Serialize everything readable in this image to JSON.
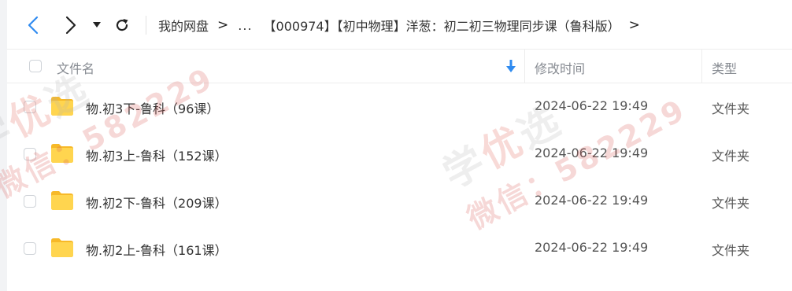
{
  "nav": {
    "breadcrumb": {
      "root": "我的网盘",
      "ellipsis": "...",
      "current": "【000974】【初中物理】洋葱：初二初三物理同步课（鲁科版）"
    }
  },
  "table": {
    "headers": {
      "name": "文件名",
      "modified": "修改时间",
      "type": "类型"
    },
    "rows": [
      {
        "name": "物.初3下-鲁科（96课）",
        "modified": "2024-06-22 19:49",
        "type": "文件夹"
      },
      {
        "name": "物.初3上-鲁科（152课）",
        "modified": "2024-06-22 19:49",
        "type": "文件夹"
      },
      {
        "name": "物.初2下-鲁科（209课）",
        "modified": "2024-06-22 19:49",
        "type": "文件夹"
      },
      {
        "name": "物.初2上-鲁科（161课）",
        "modified": "2024-06-22 19:49",
        "type": "文件夹"
      }
    ]
  },
  "watermark": {
    "line1a": "学",
    "line1b": "优",
    "line1c": "选",
    "line2": "微信：582229"
  },
  "colors": {
    "accent": "#2f8bf0",
    "folder": "#ffc93c"
  }
}
